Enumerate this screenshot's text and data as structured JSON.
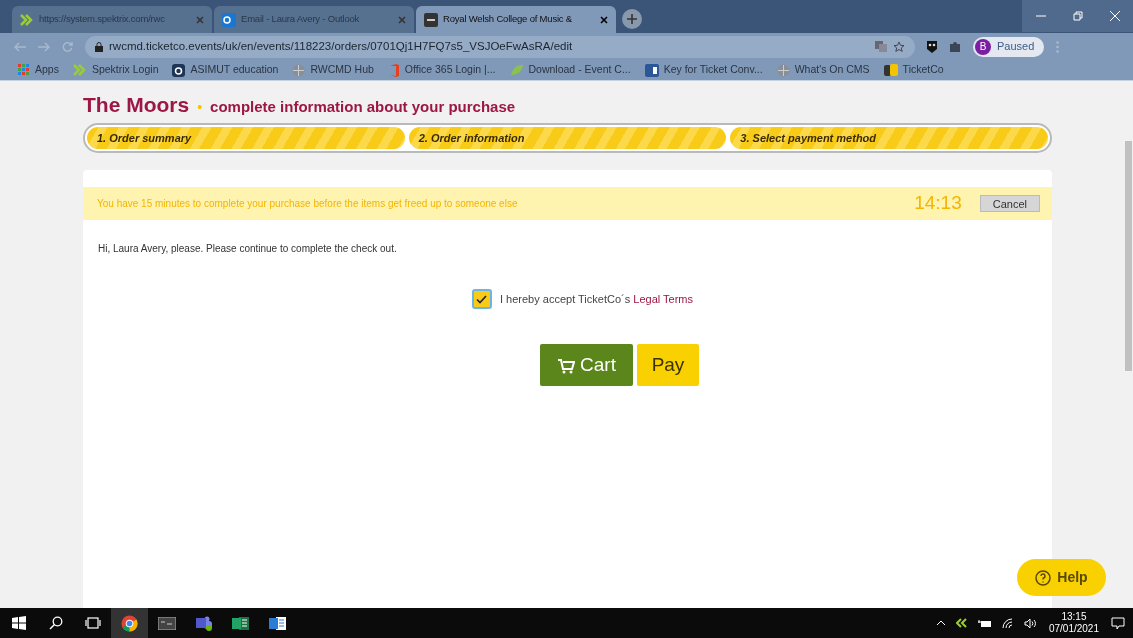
{
  "browser": {
    "tabs": [
      {
        "title": "https://system.spektrix.com/rwc",
        "selected": false
      },
      {
        "title": "Email - Laura Avery - Outlook",
        "selected": false
      },
      {
        "title": "Royal Welsh College of Music &",
        "selected": true
      }
    ],
    "url": "rwcmd.ticketco.events/uk/en/events/118223/orders/0701Qj1H7FQ7s5_VSJOeFwAsRA/edit",
    "profile": {
      "initial": "B",
      "label": "Paused"
    },
    "bookmarks": [
      "Apps",
      "Spektrix Login",
      "ASIMUT education",
      "RWCMD Hub",
      "Office 365 Login |...",
      "Download - Event C...",
      "Key for Ticket Conv...",
      "What's On CMS",
      "TicketCo"
    ]
  },
  "page": {
    "title": "The Moors",
    "bullet": "•",
    "subtitle": "complete information about your purchase",
    "steps": [
      "1. Order summary",
      "2. Order information",
      "3. Select payment method"
    ],
    "notice": "You have 15 minutes to complete your purchase before the items get freed up to someone else",
    "timer": "14:13",
    "cancel": "Cancel",
    "greeting": "Hi, Laura Avery, please. Please continue to complete the check out.",
    "terms": {
      "checked": true,
      "text": "I hereby accept TicketCo´s",
      "link": "Legal Terms"
    },
    "cart": "Cart",
    "pay": "Pay",
    "help": "Help"
  },
  "taskbar": {
    "time": "13:15",
    "date": "07/01/2021"
  }
}
